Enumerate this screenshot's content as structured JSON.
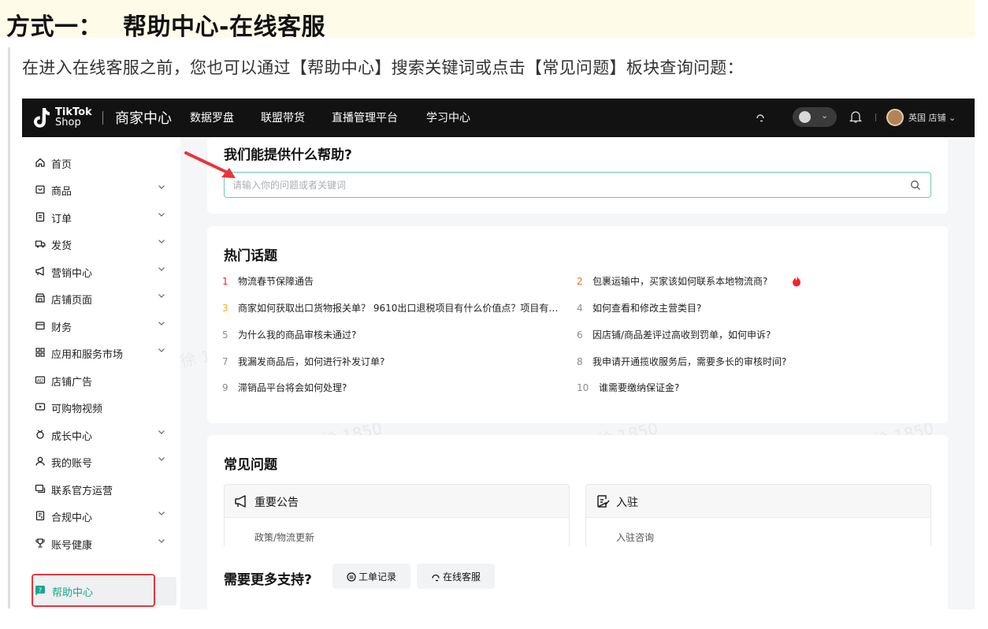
{
  "doc": {
    "heading_prefix": "方式一：",
    "heading_title": "帮助中心-在线客服",
    "paragraph": "在进入在线客服之前，您也可以通过【帮助中心】搜索关键词或点击【常见问题】板块查询问题："
  },
  "topbar": {
    "logo_line1": "TikTok",
    "logo_line2": "Shop",
    "title": "商家中心",
    "nav": [
      "数据罗盘",
      "联盟带货",
      "直播管理平台",
      "学习中心"
    ],
    "store_label": "英国 店铺"
  },
  "sidebar": {
    "items": [
      {
        "label": "首页",
        "icon": "home-icon",
        "chevron": false
      },
      {
        "label": "商品",
        "icon": "product-icon",
        "chevron": true
      },
      {
        "label": "订单",
        "icon": "order-icon",
        "chevron": true
      },
      {
        "label": "发货",
        "icon": "truck-icon",
        "chevron": true
      },
      {
        "label": "营销中心",
        "icon": "megaphone-icon",
        "chevron": true
      },
      {
        "label": "店铺页面",
        "icon": "store-icon",
        "chevron": true
      },
      {
        "label": "财务",
        "icon": "wallet-icon",
        "chevron": true
      },
      {
        "label": "应用和服务市场",
        "icon": "apps-icon",
        "chevron": true
      },
      {
        "label": "店铺广告",
        "icon": "ad-icon",
        "chevron": false
      },
      {
        "label": "可购物视频",
        "icon": "video-icon",
        "chevron": false
      },
      {
        "label": "成长中心",
        "icon": "growth-icon",
        "chevron": true
      },
      {
        "label": "我的账号",
        "icon": "user-icon",
        "chevron": true
      },
      {
        "label": "联系官方运营",
        "icon": "chat-icon",
        "chevron": false
      },
      {
        "label": "合规中心",
        "icon": "compliance-icon",
        "chevron": true
      },
      {
        "label": "账号健康",
        "icon": "trophy-icon",
        "chevron": true
      }
    ],
    "help_label": "帮助中心"
  },
  "help": {
    "title": "我们能提供什么帮助?",
    "search_placeholder": "请输入你的问题或者关键词"
  },
  "hot": {
    "title": "热门话题",
    "topics": [
      {
        "num": "1",
        "text": "物流春节保障通告"
      },
      {
        "num": "2",
        "text": "包裹运输中，买家该如何联系本地物流商?"
      },
      {
        "num": "3",
        "text": "商家如何获取出口货物报关单？ 9610出口退税项目有什么价值点？项目有…"
      },
      {
        "num": "4",
        "text": "如何查看和修改主营类目?"
      },
      {
        "num": "5",
        "text": "为什么我的商品审核未通过?"
      },
      {
        "num": "6",
        "text": "因店铺/商品差评过高收到罚单，如何申诉?"
      },
      {
        "num": "7",
        "text": "我漏发商品后，如何进行补发订单?"
      },
      {
        "num": "8",
        "text": "我申请开通揽收服务后，需要多长的审核时间?"
      },
      {
        "num": "9",
        "text": "滞销品平台将会如何处理?"
      },
      {
        "num": "10",
        "text": "谁需要缴纳保证金?"
      }
    ]
  },
  "faq": {
    "title": "常见问题",
    "boxes": [
      {
        "label": "重要公告",
        "sub": "政策/物流更新",
        "icon": "megaphone-icon"
      },
      {
        "label": "入驻",
        "sub": "入驻咨询",
        "icon": "checklist-icon"
      }
    ]
  },
  "more": {
    "title": "需要更多支持?",
    "ticket_label": "工单记录",
    "service_label": "在线客服"
  },
  "watermark": "徐 1850",
  "colors": {
    "accent": "#6ec7bd",
    "highlight_red": "#e8353d",
    "topbar_bg": "#121212"
  }
}
